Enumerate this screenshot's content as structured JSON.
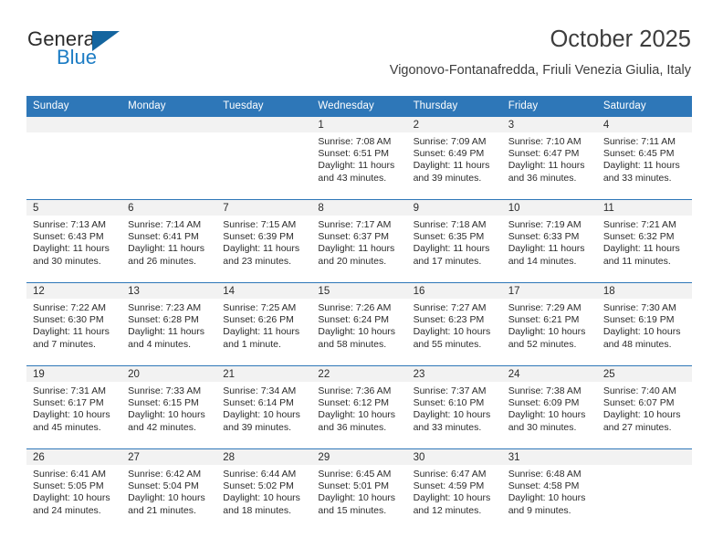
{
  "brand": {
    "name_top": "General",
    "name_bottom": "Blue",
    "color_dark": "#2b2b2b",
    "color_blue": "#1c7cc4",
    "triangle_color": "#14659f"
  },
  "header": {
    "title": "October 2025",
    "subtitle": "Vigonovo-Fontanafredda, Friuli Venezia Giulia, Italy"
  },
  "theme": {
    "header_blue": "#2e77b8",
    "daynum_band": "#f2f2f2",
    "text": "#2b2b2b"
  },
  "calendar": {
    "weekday_headers": [
      "Sunday",
      "Monday",
      "Tuesday",
      "Wednesday",
      "Thursday",
      "Friday",
      "Saturday"
    ],
    "weeks": [
      [
        {
          "day": "",
          "empty": true
        },
        {
          "day": "",
          "empty": true
        },
        {
          "day": "",
          "empty": true
        },
        {
          "day": "1",
          "sunrise": "Sunrise: 7:08 AM",
          "sunset": "Sunset: 6:51 PM",
          "daylight1": "Daylight: 11 hours",
          "daylight2": "and 43 minutes."
        },
        {
          "day": "2",
          "sunrise": "Sunrise: 7:09 AM",
          "sunset": "Sunset: 6:49 PM",
          "daylight1": "Daylight: 11 hours",
          "daylight2": "and 39 minutes."
        },
        {
          "day": "3",
          "sunrise": "Sunrise: 7:10 AM",
          "sunset": "Sunset: 6:47 PM",
          "daylight1": "Daylight: 11 hours",
          "daylight2": "and 36 minutes."
        },
        {
          "day": "4",
          "sunrise": "Sunrise: 7:11 AM",
          "sunset": "Sunset: 6:45 PM",
          "daylight1": "Daylight: 11 hours",
          "daylight2": "and 33 minutes."
        }
      ],
      [
        {
          "day": "5",
          "sunrise": "Sunrise: 7:13 AM",
          "sunset": "Sunset: 6:43 PM",
          "daylight1": "Daylight: 11 hours",
          "daylight2": "and 30 minutes."
        },
        {
          "day": "6",
          "sunrise": "Sunrise: 7:14 AM",
          "sunset": "Sunset: 6:41 PM",
          "daylight1": "Daylight: 11 hours",
          "daylight2": "and 26 minutes."
        },
        {
          "day": "7",
          "sunrise": "Sunrise: 7:15 AM",
          "sunset": "Sunset: 6:39 PM",
          "daylight1": "Daylight: 11 hours",
          "daylight2": "and 23 minutes."
        },
        {
          "day": "8",
          "sunrise": "Sunrise: 7:17 AM",
          "sunset": "Sunset: 6:37 PM",
          "daylight1": "Daylight: 11 hours",
          "daylight2": "and 20 minutes."
        },
        {
          "day": "9",
          "sunrise": "Sunrise: 7:18 AM",
          "sunset": "Sunset: 6:35 PM",
          "daylight1": "Daylight: 11 hours",
          "daylight2": "and 17 minutes."
        },
        {
          "day": "10",
          "sunrise": "Sunrise: 7:19 AM",
          "sunset": "Sunset: 6:33 PM",
          "daylight1": "Daylight: 11 hours",
          "daylight2": "and 14 minutes."
        },
        {
          "day": "11",
          "sunrise": "Sunrise: 7:21 AM",
          "sunset": "Sunset: 6:32 PM",
          "daylight1": "Daylight: 11 hours",
          "daylight2": "and 11 minutes."
        }
      ],
      [
        {
          "day": "12",
          "sunrise": "Sunrise: 7:22 AM",
          "sunset": "Sunset: 6:30 PM",
          "daylight1": "Daylight: 11 hours",
          "daylight2": "and 7 minutes."
        },
        {
          "day": "13",
          "sunrise": "Sunrise: 7:23 AM",
          "sunset": "Sunset: 6:28 PM",
          "daylight1": "Daylight: 11 hours",
          "daylight2": "and 4 minutes."
        },
        {
          "day": "14",
          "sunrise": "Sunrise: 7:25 AM",
          "sunset": "Sunset: 6:26 PM",
          "daylight1": "Daylight: 11 hours",
          "daylight2": "and 1 minute."
        },
        {
          "day": "15",
          "sunrise": "Sunrise: 7:26 AM",
          "sunset": "Sunset: 6:24 PM",
          "daylight1": "Daylight: 10 hours",
          "daylight2": "and 58 minutes."
        },
        {
          "day": "16",
          "sunrise": "Sunrise: 7:27 AM",
          "sunset": "Sunset: 6:23 PM",
          "daylight1": "Daylight: 10 hours",
          "daylight2": "and 55 minutes."
        },
        {
          "day": "17",
          "sunrise": "Sunrise: 7:29 AM",
          "sunset": "Sunset: 6:21 PM",
          "daylight1": "Daylight: 10 hours",
          "daylight2": "and 52 minutes."
        },
        {
          "day": "18",
          "sunrise": "Sunrise: 7:30 AM",
          "sunset": "Sunset: 6:19 PM",
          "daylight1": "Daylight: 10 hours",
          "daylight2": "and 48 minutes."
        }
      ],
      [
        {
          "day": "19",
          "sunrise": "Sunrise: 7:31 AM",
          "sunset": "Sunset: 6:17 PM",
          "daylight1": "Daylight: 10 hours",
          "daylight2": "and 45 minutes."
        },
        {
          "day": "20",
          "sunrise": "Sunrise: 7:33 AM",
          "sunset": "Sunset: 6:15 PM",
          "daylight1": "Daylight: 10 hours",
          "daylight2": "and 42 minutes."
        },
        {
          "day": "21",
          "sunrise": "Sunrise: 7:34 AM",
          "sunset": "Sunset: 6:14 PM",
          "daylight1": "Daylight: 10 hours",
          "daylight2": "and 39 minutes."
        },
        {
          "day": "22",
          "sunrise": "Sunrise: 7:36 AM",
          "sunset": "Sunset: 6:12 PM",
          "daylight1": "Daylight: 10 hours",
          "daylight2": "and 36 minutes."
        },
        {
          "day": "23",
          "sunrise": "Sunrise: 7:37 AM",
          "sunset": "Sunset: 6:10 PM",
          "daylight1": "Daylight: 10 hours",
          "daylight2": "and 33 minutes."
        },
        {
          "day": "24",
          "sunrise": "Sunrise: 7:38 AM",
          "sunset": "Sunset: 6:09 PM",
          "daylight1": "Daylight: 10 hours",
          "daylight2": "and 30 minutes."
        },
        {
          "day": "25",
          "sunrise": "Sunrise: 7:40 AM",
          "sunset": "Sunset: 6:07 PM",
          "daylight1": "Daylight: 10 hours",
          "daylight2": "and 27 minutes."
        }
      ],
      [
        {
          "day": "26",
          "sunrise": "Sunrise: 6:41 AM",
          "sunset": "Sunset: 5:05 PM",
          "daylight1": "Daylight: 10 hours",
          "daylight2": "and 24 minutes."
        },
        {
          "day": "27",
          "sunrise": "Sunrise: 6:42 AM",
          "sunset": "Sunset: 5:04 PM",
          "daylight1": "Daylight: 10 hours",
          "daylight2": "and 21 minutes."
        },
        {
          "day": "28",
          "sunrise": "Sunrise: 6:44 AM",
          "sunset": "Sunset: 5:02 PM",
          "daylight1": "Daylight: 10 hours",
          "daylight2": "and 18 minutes."
        },
        {
          "day": "29",
          "sunrise": "Sunrise: 6:45 AM",
          "sunset": "Sunset: 5:01 PM",
          "daylight1": "Daylight: 10 hours",
          "daylight2": "and 15 minutes."
        },
        {
          "day": "30",
          "sunrise": "Sunrise: 6:47 AM",
          "sunset": "Sunset: 4:59 PM",
          "daylight1": "Daylight: 10 hours",
          "daylight2": "and 12 minutes."
        },
        {
          "day": "31",
          "sunrise": "Sunrise: 6:48 AM",
          "sunset": "Sunset: 4:58 PM",
          "daylight1": "Daylight: 10 hours",
          "daylight2": "and 9 minutes."
        },
        {
          "day": "",
          "empty": true
        }
      ]
    ]
  }
}
